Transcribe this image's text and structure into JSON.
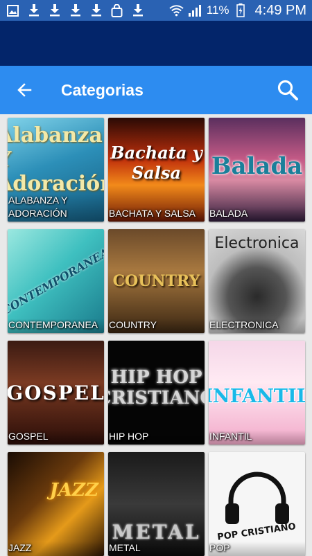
{
  "status_bar": {
    "battery": "11%",
    "time": "4:49 PM",
    "notification_icons": [
      "image-icon",
      "download-icon",
      "download-icon",
      "download-icon",
      "download-icon",
      "shopping-bag-icon",
      "download-icon"
    ]
  },
  "app_bar": {
    "title": "Categorias",
    "back_icon": "arrow-left-icon",
    "search_icon": "search-icon"
  },
  "colors": {
    "status_bar": "#2a62b3",
    "dark_band": "#03256a",
    "app_bar": "#2d8cf0",
    "background": "#e9e9e9"
  },
  "categories": [
    {
      "label": "ALABANZA Y ADORACIÓN",
      "art_text": "Alabanza Y Adoración"
    },
    {
      "label": "BACHATA Y SALSA",
      "art_text": "Bachata y Salsa"
    },
    {
      "label": "BALADA",
      "art_text": "Balada"
    },
    {
      "label": "CONTEMPORANEA",
      "art_text": "CONTEMPORANEA"
    },
    {
      "label": "COUNTRY",
      "art_text": "COUNTRY"
    },
    {
      "label": "ELECTRONICA",
      "art_text": "Electronica"
    },
    {
      "label": "GOSPEL",
      "art_text": "GOSPEL"
    },
    {
      "label": "HIP HOP",
      "art_text": "HIP HOP CRISTIANO"
    },
    {
      "label": "INFANTIL",
      "art_text": "INFANTIL"
    },
    {
      "label": "JAZZ",
      "art_text": "JAZZ"
    },
    {
      "label": "METAL",
      "art_text": "METAL"
    },
    {
      "label": "POP",
      "art_text": "POP CRISTIANO"
    }
  ]
}
